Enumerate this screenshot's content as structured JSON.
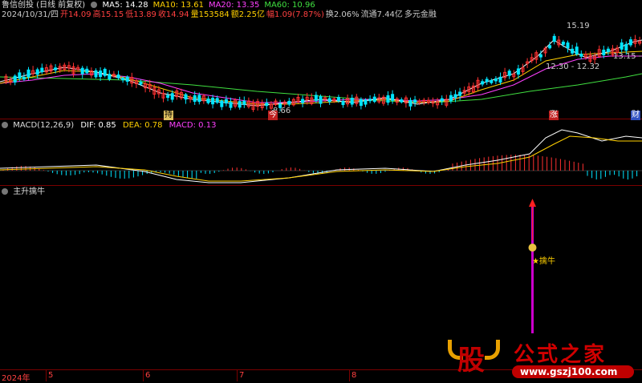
{
  "header": {
    "title": "鲁信创投 (日线 前复权)",
    "ma": [
      {
        "label": "MA5: 14.28",
        "color": "#ffffff"
      },
      {
        "label": "MA10: 13.61",
        "color": "#ffd000"
      },
      {
        "label": "MA20: 13.35",
        "color": "#ff40ff"
      },
      {
        "label": "MA60: 10.96",
        "color": "#40e040"
      }
    ],
    "quote": [
      {
        "label": "2024/10/31/四",
        "color": "#cccccc"
      },
      {
        "label": "开14.09",
        "color": "#ff4040"
      },
      {
        "label": "高15.15",
        "color": "#ff4040"
      },
      {
        "label": "低13.89",
        "color": "#ff4040"
      },
      {
        "label": "收14.94",
        "color": "#ff4040"
      },
      {
        "label": "量153584",
        "color": "#ffd000"
      },
      {
        "label": "额2.25亿",
        "color": "#ffd000"
      },
      {
        "label": "幅1.09(7.87%)",
        "color": "#ff4040"
      },
      {
        "label": "换2.06%",
        "color": "#cccccc"
      },
      {
        "label": "流通7.44亿",
        "color": "#cccccc"
      },
      {
        "label": "多元金融",
        "color": "#cccccc"
      }
    ]
  },
  "price_chart": {
    "annotations": {
      "high": "15.19",
      "low": "8.66",
      "range": "12.30 - 12.32",
      "right": "13.15 -"
    },
    "markers": {
      "m1": "持",
      "m2": "今",
      "m3": "涨",
      "m4": "财"
    }
  },
  "macd_panel": {
    "title": "MACD(12,26,9)",
    "dif": "DIF: 0.85",
    "dea": "DEA: 0.78",
    "macd": "MACD: 0.13"
  },
  "indicator_panel": {
    "title": "主升擒牛",
    "signal_label": "★擒牛"
  },
  "x_axis": {
    "labels": [
      "2024年",
      "5",
      "6",
      "7",
      "8"
    ]
  },
  "watermark": {
    "badge": "股",
    "brand": "公式之家",
    "url": "www.gszj100.com"
  },
  "colors": {
    "up": "#ff3030",
    "down": "#00e5ff",
    "ma5": "#ffffff",
    "ma10": "#ffd000",
    "ma20": "#ff40ff",
    "ma60": "#40e040",
    "signal": "#cc00cc"
  }
}
